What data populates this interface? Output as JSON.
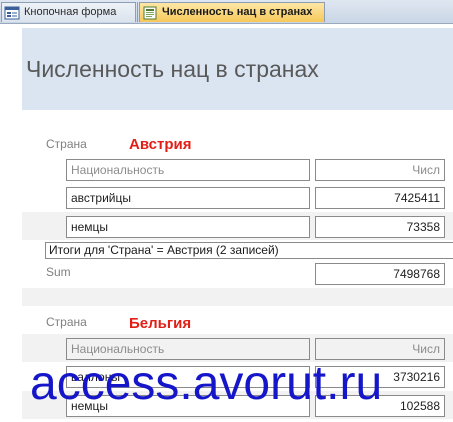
{
  "tabs": [
    {
      "label": "Кнопочная форма",
      "icon": "form-icon",
      "active": false
    },
    {
      "label": "Численность нац в странах",
      "icon": "report-icon",
      "active": true
    }
  ],
  "report": {
    "title": "Численность нац в странах"
  },
  "groups": [
    {
      "field_label": "Страна",
      "value": "Австрия",
      "columns": [
        "Национальность",
        "Числ"
      ],
      "rows": [
        {
          "nationality": "австрийцы",
          "count": "7425411"
        },
        {
          "nationality": "немцы",
          "count": "73358"
        }
      ],
      "summary_text": "Итоги для 'Страна' =  Австрия (2 записей)",
      "sum_label": "Sum",
      "sum_value": "7498768"
    },
    {
      "field_label": "Страна",
      "value": "Бельгия",
      "columns": [
        "Национальность",
        "Числ"
      ],
      "rows": [
        {
          "nationality": "валлоны",
          "count": "3730216"
        },
        {
          "nationality": "немцы",
          "count": "102588"
        }
      ]
    }
  ],
  "watermark": "access.avorut.ru",
  "colors": {
    "group_value": "#e21e16",
    "header_band": "#dbe5f1",
    "active_tab": "#f7c85a",
    "watermark": "#1515c9"
  }
}
